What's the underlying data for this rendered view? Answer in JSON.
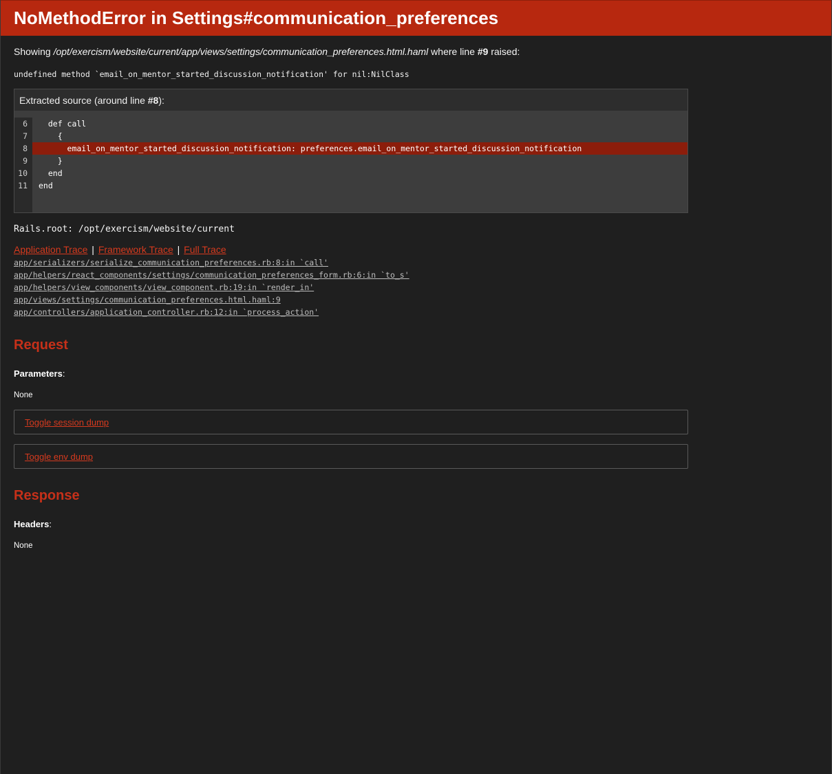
{
  "header": {
    "title": "NoMethodError in Settings#communication_preferences"
  },
  "showing": {
    "prefix": "Showing ",
    "path": "/opt/exercism/website/current/app/views/settings/communication_preferences.html.haml",
    "middle": " where line ",
    "line": "#9",
    "suffix": " raised:"
  },
  "error_message": "undefined method `email_on_mentor_started_discussion_notification' for nil:NilClass",
  "source": {
    "caption_prefix": "Extracted source (around line ",
    "caption_line": "#8",
    "caption_suffix": "):",
    "lines": [
      {
        "number": "6",
        "code": "  def call",
        "highlight": false
      },
      {
        "number": "7",
        "code": "    {",
        "highlight": false
      },
      {
        "number": "8",
        "code": "      email_on_mentor_started_discussion_notification: preferences.email_on_mentor_started_discussion_notification",
        "highlight": true
      },
      {
        "number": "9",
        "code": "    }",
        "highlight": false
      },
      {
        "number": "10",
        "code": "  end",
        "highlight": false
      },
      {
        "number": "11",
        "code": "end",
        "highlight": false
      }
    ]
  },
  "rails_root": "Rails.root: /opt/exercism/website/current",
  "trace_tabs": {
    "application": "Application Trace",
    "framework": "Framework Trace",
    "full": "Full Trace",
    "separator": "|"
  },
  "trace": [
    "app/serializers/serialize_communication_preferences.rb:8:in `call'",
    "app/helpers/react_components/settings/communication_preferences_form.rb:6:in `to_s'",
    "app/helpers/view_components/view_component.rb:19:in `render_in'",
    "app/views/settings/communication_preferences.html.haml:9",
    "app/controllers/application_controller.rb:12:in `process_action'"
  ],
  "request": {
    "heading": "Request",
    "parameters_label": "Parameters",
    "parameters_value": "None",
    "toggle_session": "Toggle session dump",
    "toggle_env": "Toggle env dump"
  },
  "response": {
    "heading": "Response",
    "headers_label": "Headers",
    "headers_value": "None"
  },
  "colors": {
    "header_bg": "#b7280f",
    "page_bg": "#1f1f1f",
    "accent": "#c63019",
    "highlight_line": "#8c1d0b"
  }
}
